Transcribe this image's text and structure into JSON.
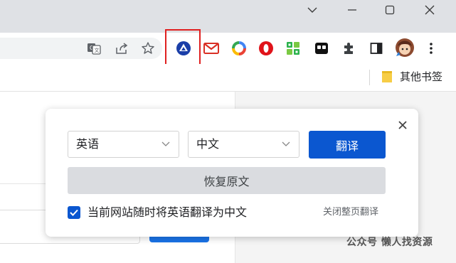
{
  "window": {
    "controls": [
      "chevron-down",
      "minimize",
      "maximize",
      "close"
    ]
  },
  "toolbar": {
    "icons": [
      "translate-icon",
      "share-icon",
      "star-icon",
      "translator-extension-icon",
      "gmail-icon",
      "color-ring-icon",
      "opera-icon",
      "qr-grid-icon",
      "mask-icon",
      "puzzle-icon",
      "sidepanel-icon",
      "avatar",
      "more-icon"
    ],
    "highlight_color": "#e02020"
  },
  "bookmarks": {
    "other_bookmarks_label": "其他书签"
  },
  "translate_popup": {
    "source_language": "英语",
    "target_language": "中文",
    "translate_button": "翻译",
    "restore_button": "恢复原文",
    "always_translate_label": "当前网站随时将英语翻译为中文",
    "always_translate_checked": true,
    "close_page_translate_link": "关闭整页翻译",
    "accent_color": "#0b57d0"
  },
  "watermark": {
    "text": "公众号 懒人找资源"
  }
}
